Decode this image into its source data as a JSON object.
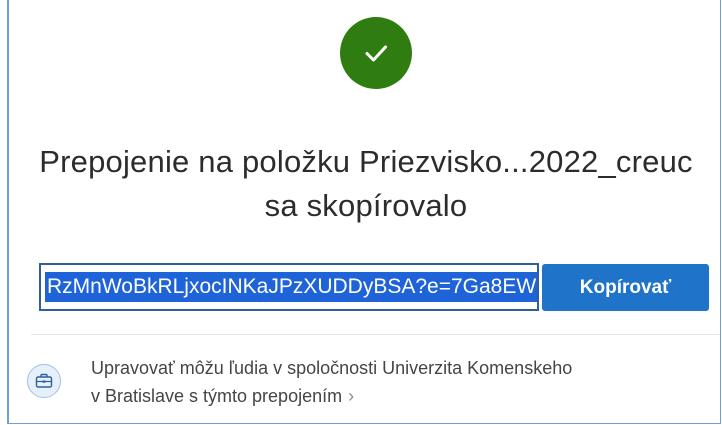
{
  "dialog": {
    "title_line1": "Prepojenie na položku Priezvisko...2022_creuc",
    "title_line2": "sa skopírovalo",
    "link_value": "RzMnWoBkRLjxocINKaJPzXUDDyBSA?e=7Ga8EW",
    "copy_button_label": "Kopírovať",
    "permission_line1": "Upravovať môžu ľudia v spoločnosti Univerzita Komenskeho",
    "permission_line2": "v Bratislave s týmto prepojením",
    "permission_chevron": "›"
  },
  "icons": {
    "success": "checkmark-icon",
    "permission": "briefcase-icon"
  },
  "colors": {
    "success_green": "#2f7d10",
    "accent_blue": "#1f73c8",
    "selection_blue": "#1f63d9",
    "border_blue": "#6d9fd8"
  }
}
